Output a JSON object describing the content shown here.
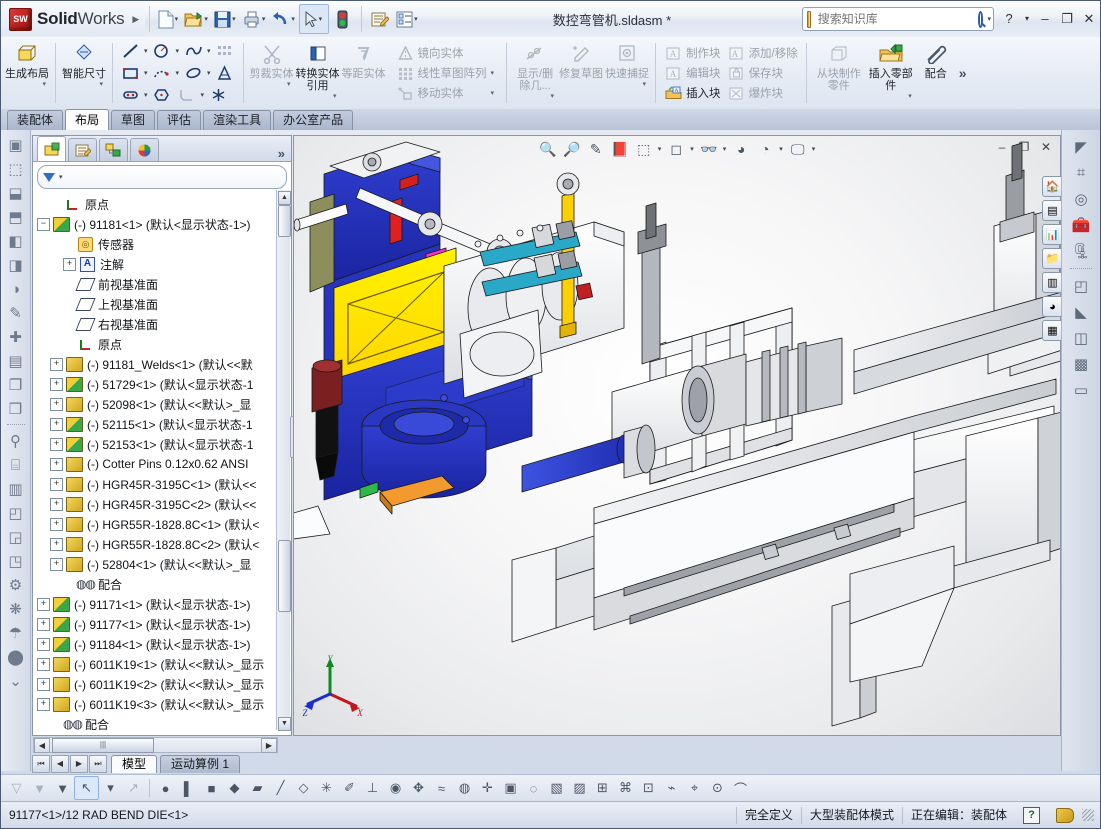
{
  "app": {
    "brand_bold": "Solid",
    "brand_light": "Works",
    "logo_text": "SW",
    "document_title": "数控弯管机.sldasm *",
    "brand_arrow": "▶"
  },
  "quick_access": [
    {
      "name": "new-document",
      "glyph": "🗋",
      "caret": true
    },
    {
      "name": "open-document",
      "glyph": "📂",
      "caret": true
    },
    {
      "name": "save-document",
      "glyph": "💾",
      "caret": true
    },
    {
      "name": "print-document",
      "glyph": "🖨",
      "caret": true
    },
    {
      "name": "undo",
      "glyph": "↺",
      "caret": true
    },
    {
      "name": "select",
      "glyph": "↖",
      "caret": true
    },
    {
      "name": "rebuild",
      "glyph": "🚦",
      "caret": false
    },
    {
      "name": "options",
      "glyph": "📋",
      "caret": false
    },
    {
      "name": "customize",
      "glyph": "🗒",
      "caret": true
    }
  ],
  "search": {
    "placeholder": "搜索知识库",
    "value": ""
  },
  "window_buttons": {
    "help": "?",
    "help_caret": "▾",
    "minimize": "–",
    "restore": "❐",
    "close": "✕"
  },
  "ribbon": {
    "groups": [
      {
        "name": "layout-group",
        "big": [
          {
            "label": "生成\n布局",
            "label_text": "生成布局",
            "icon": "layout-icon",
            "glyph": "▱",
            "dropdown": true,
            "dim": false
          }
        ]
      },
      {
        "name": "dimension-group",
        "big": [
          {
            "label_text": "智能尺寸",
            "icon": "smart-dimension-icon",
            "glyph": "◈",
            "dropdown": true,
            "dim": false
          }
        ]
      },
      {
        "name": "sketch-entities-group",
        "icons_row1": [
          "line-icon",
          "circle-icon",
          "spline-icon",
          "sketch-pattern-icon"
        ],
        "icons_row2": [
          "rectangle-icon",
          "arc-icon",
          "ellipse-icon",
          "text-icon"
        ],
        "icons_row3": [
          "slot-icon",
          "polygon-icon",
          "fillet-icon",
          "point-icon"
        ]
      },
      {
        "name": "trim-group",
        "big": [
          {
            "label_text": "剪裁实体",
            "icon": "trim-entities-icon",
            "glyph": "✂",
            "dropdown": true,
            "dim": true
          },
          {
            "label_text": "转换实体引用",
            "icon": "convert-entities-icon",
            "glyph": "◳",
            "dropdown": true,
            "dim": false
          },
          {
            "label_text": "等距实体",
            "icon": "offset-entities-icon",
            "glyph": "⟯",
            "dropdown": false,
            "dim": true
          }
        ]
      },
      {
        "name": "sketch-tools-group",
        "small": [
          {
            "label": "镜向实体",
            "icon": "mirror-entities-icon",
            "glyph": "⚠",
            "dim": true,
            "dropdown": false
          },
          {
            "label": "线性草图阵列",
            "icon": "linear-sketch-pattern-icon",
            "glyph": "▦",
            "dim": true,
            "dropdown": true
          },
          {
            "label": "移动实体",
            "icon": "move-entities-icon",
            "glyph": "⇲",
            "dim": true,
            "dropdown": true
          }
        ]
      },
      {
        "name": "relations-group",
        "big": [
          {
            "label_text": "显示/删除几...",
            "icon": "display-delete-relations-icon",
            "glyph": "∡",
            "dropdown": true,
            "dim": true
          },
          {
            "label_text": "修复草图",
            "icon": "repair-sketch-icon",
            "glyph": "✎",
            "dropdown": false,
            "dim": true
          },
          {
            "label_text": "快速捕捉",
            "icon": "quick-snaps-icon",
            "glyph": "◎",
            "dropdown": true,
            "dim": true
          }
        ]
      },
      {
        "name": "blocks-group",
        "small": [
          {
            "label": "制作块",
            "icon": "make-block-icon",
            "glyph": "A",
            "dim": true,
            "dropdown": false
          },
          {
            "label": "编辑块",
            "icon": "edit-block-icon",
            "glyph": "A",
            "dim": true,
            "dropdown": false
          },
          {
            "label": "插入块",
            "icon": "insert-block-icon",
            "glyph": "A",
            "dim": false,
            "dropdown": false
          }
        ],
        "small2": [
          {
            "label": "添加/移除",
            "icon": "add-remove-block-icon",
            "glyph": "A",
            "dim": true,
            "dropdown": false
          },
          {
            "label": "保存块",
            "icon": "save-block-icon",
            "glyph": "🔒",
            "dim": true,
            "dropdown": false
          },
          {
            "label": "爆炸块",
            "icon": "explode-block-icon",
            "glyph": "✸",
            "dim": true,
            "dropdown": false
          }
        ]
      },
      {
        "name": "assembly-group",
        "big": [
          {
            "label_text": "从块制作零件",
            "icon": "make-part-from-block-icon",
            "glyph": "❏",
            "dropdown": false,
            "dim": true
          },
          {
            "label_text": "插入零部件",
            "icon": "insert-components-icon",
            "glyph": "📂",
            "dropdown": true,
            "dim": false
          },
          {
            "label_text": "配合",
            "icon": "mate-icon",
            "glyph": "🖇",
            "dropdown": false,
            "dim": false
          }
        ],
        "overflow": "»"
      }
    ]
  },
  "command_tabs": [
    {
      "label": "装配体",
      "active": false
    },
    {
      "label": "布局",
      "active": true
    },
    {
      "label": "草图",
      "active": false
    },
    {
      "label": "评估",
      "active": false
    },
    {
      "label": "渲染工具",
      "active": false
    },
    {
      "label": "办公室产品",
      "active": false
    }
  ],
  "left_toolbar": [
    {
      "name": "view-orientation-icon",
      "glyph": "▣"
    },
    {
      "name": "isometric-view-icon",
      "glyph": "⬚"
    },
    {
      "name": "trimetric-view-icon",
      "glyph": "⬓"
    },
    {
      "name": "dimetric-view-icon",
      "glyph": "⬒"
    },
    {
      "name": "front-view-icon",
      "glyph": "◧"
    },
    {
      "name": "back-view-icon",
      "glyph": "◨"
    },
    {
      "name": "section-view-icon",
      "glyph": "◑"
    },
    {
      "name": "sketch-icon",
      "glyph": "✎"
    },
    {
      "name": "add-sketch-icon",
      "glyph": "✚"
    },
    {
      "name": "sketch-plane-icon",
      "glyph": "▤"
    },
    {
      "name": "copy-icon",
      "glyph": "❐"
    },
    {
      "name": "paste-icon",
      "glyph": "❒"
    },
    {
      "name": "separator",
      "glyph": "·"
    },
    {
      "name": "bolt-icon",
      "glyph": "⚲"
    },
    {
      "name": "smart-fastener-icon",
      "glyph": "⌸"
    },
    {
      "name": "component-icon",
      "glyph": "▥"
    },
    {
      "name": "weldment-icon",
      "glyph": "◰"
    },
    {
      "name": "mold-icon",
      "glyph": "◲"
    },
    {
      "name": "surface-icon",
      "glyph": "◳"
    },
    {
      "name": "settings-icon",
      "glyph": "⚙"
    },
    {
      "name": "simulation-icon",
      "glyph": "❋"
    },
    {
      "name": "flow-icon",
      "glyph": "☂"
    },
    {
      "name": "location-icon",
      "glyph": "⬤"
    },
    {
      "name": "expand-down-icon",
      "glyph": "⌄"
    }
  ],
  "feature_manager": {
    "tabs": [
      {
        "name": "feature-tree-tab",
        "glyph": "◧",
        "active": true
      },
      {
        "name": "property-manager-tab",
        "glyph": "▤",
        "active": false
      },
      {
        "name": "configuration-manager-tab",
        "glyph": "▣",
        "active": false
      },
      {
        "name": "display-manager-tab",
        "glyph": "◕",
        "active": false
      }
    ],
    "expand_chevron": "»",
    "filter_placeholder": "",
    "filter_caret": "▾",
    "tree": [
      {
        "indent": 1,
        "expander": "",
        "icon": "origin-icon",
        "label": "原点"
      },
      {
        "indent": 0,
        "expander": "−",
        "icon": "assembly-icon",
        "label": "(-) 91181<1>  (默认<显示状态-1>)"
      },
      {
        "indent": 2,
        "expander": "",
        "icon": "sensor-icon",
        "label": "传感器"
      },
      {
        "indent": 2,
        "expander": "+",
        "icon": "annotation-icon",
        "label": "注解"
      },
      {
        "indent": 2,
        "expander": "",
        "icon": "plane-icon",
        "label": "前视基准面"
      },
      {
        "indent": 2,
        "expander": "",
        "icon": "plane-icon",
        "label": "上视基准面"
      },
      {
        "indent": 2,
        "expander": "",
        "icon": "plane-icon",
        "label": "右视基准面"
      },
      {
        "indent": 2,
        "expander": "",
        "icon": "origin-icon",
        "label": "原点"
      },
      {
        "indent": 1,
        "expander": "+",
        "icon": "part-icon",
        "label": "(-) 91181_Welds<1>  (默认<<默"
      },
      {
        "indent": 1,
        "expander": "+",
        "icon": "assembly-icon",
        "label": "(-) 51729<1>  (默认<显示状态-1"
      },
      {
        "indent": 1,
        "expander": "+",
        "icon": "part-icon",
        "label": "(-) 52098<1>  (默认<<默认>_显"
      },
      {
        "indent": 1,
        "expander": "+",
        "icon": "assembly-icon",
        "label": "(-) 52115<1>  (默认<显示状态-1"
      },
      {
        "indent": 1,
        "expander": "+",
        "icon": "assembly-icon",
        "label": "(-) 52153<1>  (默认<显示状态-1"
      },
      {
        "indent": 1,
        "expander": "+",
        "icon": "part-icon",
        "label": "(-) Cotter Pins 0.12x0.62 ANSI"
      },
      {
        "indent": 1,
        "expander": "+",
        "icon": "part-icon",
        "label": "(-) HGR45R-3195C<1>  (默认<<"
      },
      {
        "indent": 1,
        "expander": "+",
        "icon": "part-icon",
        "label": "(-) HGR45R-3195C<2>  (默认<<"
      },
      {
        "indent": 1,
        "expander": "+",
        "icon": "part-icon",
        "label": "(-) HGR55R-1828.8C<1>  (默认<"
      },
      {
        "indent": 1,
        "expander": "+",
        "icon": "part-icon",
        "label": "(-) HGR55R-1828.8C<2>  (默认<"
      },
      {
        "indent": 1,
        "expander": "+",
        "icon": "part-icon",
        "label": "(-) 52804<1>  (默认<<默认>_显"
      },
      {
        "indent": 2,
        "expander": "",
        "icon": "mates-icon",
        "label": "配合"
      },
      {
        "indent": 0,
        "expander": "+",
        "icon": "assembly-icon",
        "label": "(-) 91171<1>  (默认<显示状态-1>)"
      },
      {
        "indent": 0,
        "expander": "+",
        "icon": "assembly-icon",
        "label": "(-) 91177<1>  (默认<显示状态-1>)"
      },
      {
        "indent": 0,
        "expander": "+",
        "icon": "assembly-icon",
        "label": "(-) 91184<1>  (默认<显示状态-1>)"
      },
      {
        "indent": 0,
        "expander": "+",
        "icon": "part-icon",
        "label": "(-) 6011K19<1>  (默认<<默认>_显示"
      },
      {
        "indent": 0,
        "expander": "+",
        "icon": "part-icon",
        "label": "(-) 6011K19<2>  (默认<<默认>_显示"
      },
      {
        "indent": 0,
        "expander": "+",
        "icon": "part-icon",
        "label": "(-) 6011K19<3>  (默认<<默认>_显示"
      },
      {
        "indent": 1,
        "expander": "",
        "icon": "mates-icon",
        "label": "配合"
      }
    ],
    "hscroll_thumb_glyph": "|||",
    "scroll_up": "▲",
    "scroll_down": "▼",
    "hscroll_left": "◀",
    "hscroll_right": "▶"
  },
  "viewport": {
    "toolbar": [
      {
        "name": "zoom-to-fit-icon",
        "glyph": "🔍",
        "caret": false
      },
      {
        "name": "zoom-to-area-icon",
        "glyph": "🔎",
        "caret": false
      },
      {
        "name": "previous-view-icon",
        "glyph": "✎",
        "caret": false
      },
      {
        "name": "section-view-icon",
        "glyph": "📕",
        "caret": false
      },
      {
        "name": "view-orientation-icon",
        "glyph": "⬚",
        "caret": true
      },
      {
        "name": "display-style-icon",
        "glyph": "◻",
        "caret": true
      },
      {
        "name": "hide-show-items-icon",
        "glyph": "👓",
        "caret": true
      },
      {
        "name": "appearance-icon",
        "glyph": "◕",
        "caret": false
      },
      {
        "name": "scene-icon",
        "glyph": "◔",
        "caret": true
      },
      {
        "name": "view-settings-icon",
        "glyph": "🖵",
        "caret": true
      }
    ],
    "window_controls": {
      "minimize": "–",
      "restore": "❐",
      "close": "✕"
    },
    "triad": {
      "x": "X",
      "y": "Y",
      "z": "Z"
    },
    "side_icons": [
      {
        "name": "home-icon",
        "glyph": "🏠"
      },
      {
        "name": "library-icon",
        "glyph": "▤"
      },
      {
        "name": "chart-icon",
        "glyph": "📊"
      },
      {
        "name": "folder-icon",
        "glyph": "📁"
      },
      {
        "name": "view-palette-icon",
        "glyph": "▥"
      },
      {
        "name": "appearance-sphere-icon",
        "glyph": "◕"
      },
      {
        "name": "custom-props-icon",
        "glyph": "▦"
      }
    ]
  },
  "right_pane": [
    {
      "name": "structural-member-icon",
      "glyph": "◤"
    },
    {
      "name": "hole-series-icon",
      "glyph": "⌗"
    },
    {
      "name": "bearing-icon",
      "glyph": "◎"
    },
    {
      "name": "toolbox-icon",
      "glyph": "🧰"
    },
    {
      "name": "routing-icon",
      "glyph": "🗜"
    },
    {
      "name": "separator",
      "glyph": "·"
    },
    {
      "name": "sheetmetal-base-flange-icon",
      "glyph": "◰"
    },
    {
      "name": "edge-flange-icon",
      "glyph": "◣"
    },
    {
      "name": "jog-icon",
      "glyph": "◫"
    },
    {
      "name": "lofted-bend-icon",
      "glyph": "▩"
    },
    {
      "name": "flatten-icon",
      "glyph": "▭"
    }
  ],
  "document_tabs": {
    "nav": [
      "⏮",
      "◀",
      "▶",
      "⏭"
    ],
    "tabs": [
      {
        "label": "模型",
        "active": true
      },
      {
        "label": "运动算例 1",
        "active": false
      }
    ]
  },
  "bottom_toolbar": [
    {
      "name": "filter-off-icon",
      "glyph": "▽",
      "dim": true,
      "sel": false
    },
    {
      "name": "clear-filters-icon",
      "glyph": "▼",
      "dim": true,
      "sel": false
    },
    {
      "name": "toggle-filter-icon",
      "glyph": "▼",
      "dim": false,
      "sel": false
    },
    {
      "name": "select-pointer-icon",
      "glyph": "↖",
      "dim": false,
      "sel": true
    },
    {
      "name": "select-dropdown-caret",
      "glyph": "▾",
      "dim": false,
      "sel": false
    },
    {
      "name": "select-other-icon",
      "glyph": "↗",
      "dim": true,
      "sel": false
    },
    {
      "name": "separator",
      "glyph": "|",
      "dim": false,
      "sel": false
    },
    {
      "name": "filter-vertices-icon",
      "glyph": "●",
      "dim": false,
      "sel": false
    },
    {
      "name": "filter-edges-icon",
      "glyph": "▌",
      "dim": false,
      "sel": false
    },
    {
      "name": "filter-faces-icon",
      "glyph": "■",
      "dim": false,
      "sel": false
    },
    {
      "name": "filter-surface-bodies-icon",
      "glyph": "◆",
      "dim": false,
      "sel": false
    },
    {
      "name": "filter-solid-bodies-icon",
      "glyph": "▰",
      "dim": false,
      "sel": false
    },
    {
      "name": "filter-axes-icon",
      "glyph": "╱",
      "dim": false,
      "sel": false
    },
    {
      "name": "filter-planes-icon",
      "glyph": "◇",
      "dim": false,
      "sel": false
    },
    {
      "name": "filter-sketch-points-icon",
      "glyph": "✳",
      "dim": false,
      "sel": false
    },
    {
      "name": "filter-sketches-icon",
      "glyph": "✐",
      "dim": false,
      "sel": false
    },
    {
      "name": "filter-dimensions-icon",
      "glyph": "⊥",
      "dim": false,
      "sel": false
    },
    {
      "name": "filter-welds-icon",
      "glyph": "◉",
      "dim": false,
      "sel": false
    },
    {
      "name": "filter-components-icon",
      "glyph": "✥",
      "dim": false,
      "sel": false
    },
    {
      "name": "filter-weld-beads-icon",
      "glyph": "≈",
      "dim": false,
      "sel": false
    },
    {
      "name": "filter-midpoints-icon",
      "glyph": "◍",
      "dim": false,
      "sel": false
    },
    {
      "name": "filter-centermarks-icon",
      "glyph": "✛",
      "dim": false,
      "sel": false
    },
    {
      "name": "filter-notes-icon",
      "glyph": "▣",
      "dim": false,
      "sel": false
    },
    {
      "name": "filter-balloons-icon",
      "glyph": "◌",
      "dim": false,
      "sel": false
    },
    {
      "name": "filter-blocks-icon",
      "glyph": "▧",
      "dim": false,
      "sel": false
    },
    {
      "name": "filter-hatch-icon",
      "glyph": "▨",
      "dim": false,
      "sel": false
    },
    {
      "name": "filter-tables-icon",
      "glyph": "⊞",
      "dim": false,
      "sel": false
    },
    {
      "name": "filter-annotations-icon",
      "glyph": "⌘",
      "dim": false,
      "sel": false
    },
    {
      "name": "filter-datum-icon",
      "glyph": "⊡",
      "dim": false,
      "sel": false
    },
    {
      "name": "filter-route-points-icon",
      "glyph": "⌁",
      "dim": false,
      "sel": false
    },
    {
      "name": "filter-connection-points-icon",
      "glyph": "⌖",
      "dim": false,
      "sel": false
    },
    {
      "name": "filter-symbols-icon",
      "glyph": "⊙",
      "dim": false,
      "sel": false
    },
    {
      "name": "filter-weld-symbols-icon",
      "glyph": "⌒",
      "dim": false,
      "sel": false
    }
  ],
  "status_bar": {
    "selection": "91177<1>/12 RAD BEND DIE<1>",
    "state": "完全定义",
    "mode": "大型装配体模式",
    "editing": "正在编辑：装配体",
    "help_glyph": "?",
    "tag_icon": "tag-icon"
  }
}
